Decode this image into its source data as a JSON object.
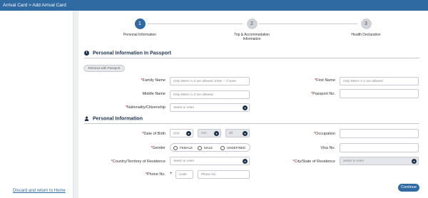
{
  "header": {
    "breadcrumb": "Arrival Card > Add Arrival Card"
  },
  "sidebar": {
    "discard_label": "Discard and return to Home"
  },
  "stepper": {
    "steps": [
      {
        "number": "1",
        "label": "Personal Information"
      },
      {
        "number": "2",
        "label": "Trip & Accommodation Information"
      },
      {
        "number": "3",
        "label": "Health Declaration"
      }
    ]
  },
  "passport_section": {
    "title": "Personal Information In Passport",
    "retrieve_label": "Retrieve with Passport",
    "family_name_label": "Family Name",
    "family_name_placeholder": "Only letters A-Z are allowed. Enter '-' if none.",
    "first_name_label": "First Name",
    "first_name_placeholder": "Only letters A-Z are allowed.",
    "middle_name_label": "Middle Name",
    "middle_name_placeholder": "Only letters A-Z are allowed.",
    "passport_no_label": "Passport No.",
    "nationality_label": "Nationality/Citizenship",
    "nationality_placeholder": "Select or enter"
  },
  "personal_section": {
    "title": "Personal Information",
    "dob_label": "Date of Birth",
    "dob_year": "yyyy",
    "dob_month": "mm",
    "dob_day": "dd",
    "occupation_label": "Occupation",
    "gender_label": "Gender",
    "gender_options": [
      "FEMALE",
      "MALE",
      "UNDEFINED"
    ],
    "visa_label": "Visa No.",
    "country_label": "Country/Territory of Residence",
    "country_placeholder": "Select or enter",
    "city_label": "City/State of Residence",
    "city_placeholder": "Select or enter",
    "phone_label": "Phone No.",
    "phone_plus": "+",
    "phone_code_placeholder": "Code",
    "phone_number_placeholder": "Phone No."
  },
  "actions": {
    "continue_label": "Continue"
  },
  "colors": {
    "primary": "#2f6aa3",
    "dark": "#1f3450",
    "required": "#dd0000"
  }
}
